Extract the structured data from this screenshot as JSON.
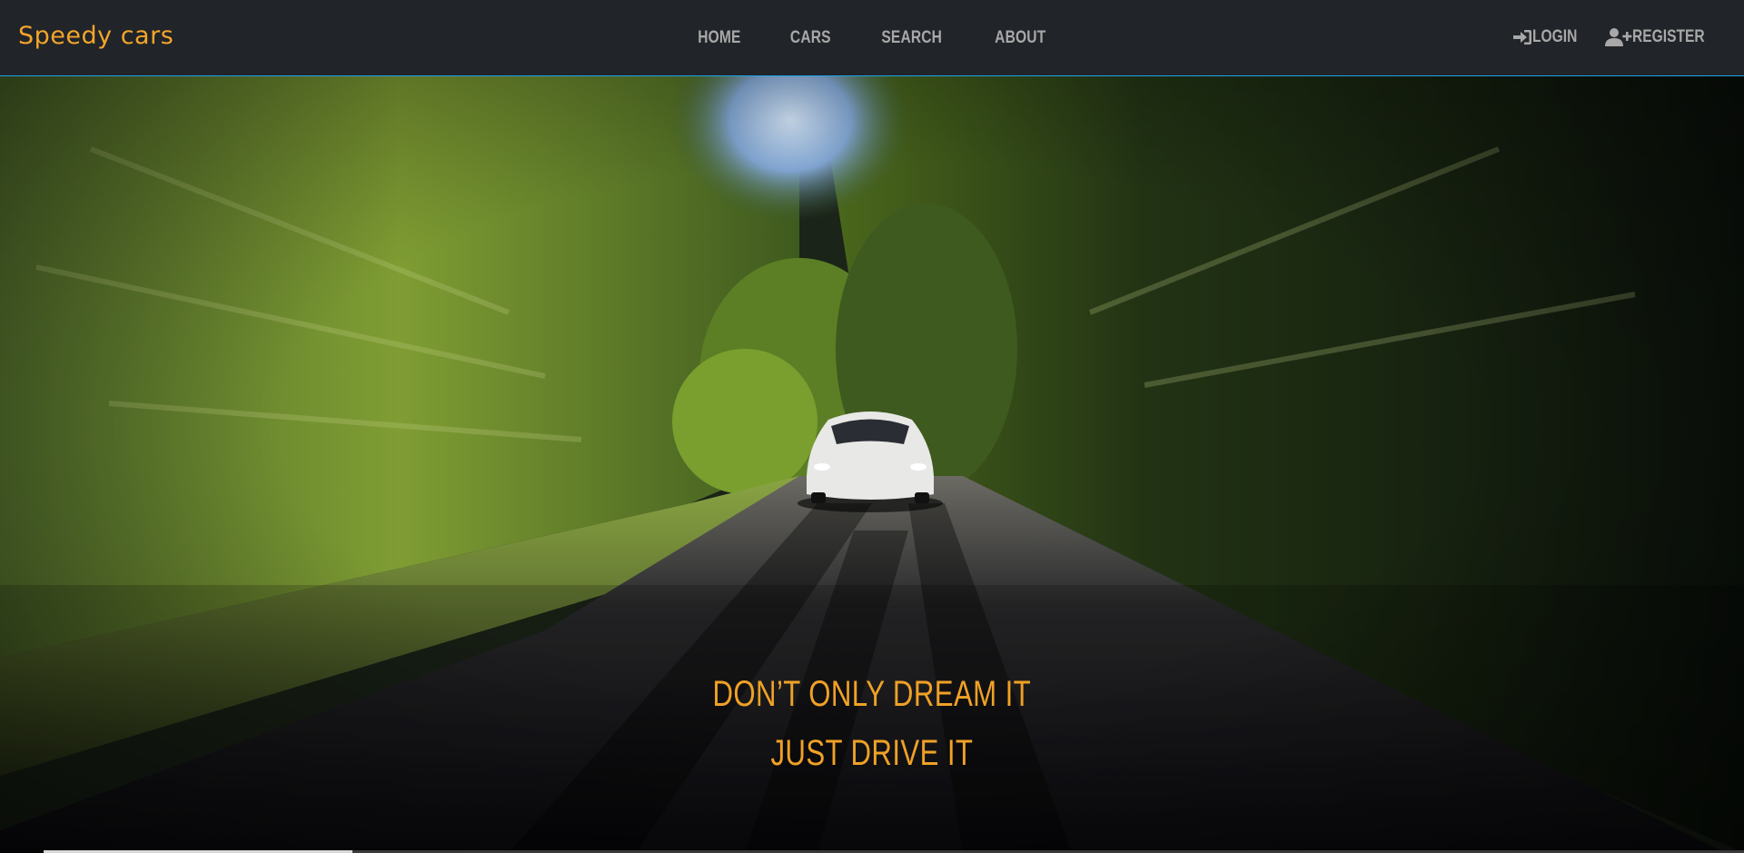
{
  "brand": {
    "name": "Speedy cars"
  },
  "nav": {
    "items": [
      {
        "label": "HOME"
      },
      {
        "label": "CARS"
      },
      {
        "label": "SEARCH"
      },
      {
        "label": "ABOUT"
      }
    ]
  },
  "auth": {
    "login_label": "LOGIN",
    "register_label": "REGISTER"
  },
  "hero": {
    "line1": "DON’T ONLY DREAM IT",
    "line2": "JUST DRIVE IT"
  },
  "colors": {
    "navbar_bg": "#212429",
    "accent": "#f4a52a",
    "nav_text": "#a8a8a8",
    "navbar_border": "#1fa3e8"
  },
  "icons": {
    "login": "sign-in-icon",
    "register": "user-plus-icon"
  }
}
